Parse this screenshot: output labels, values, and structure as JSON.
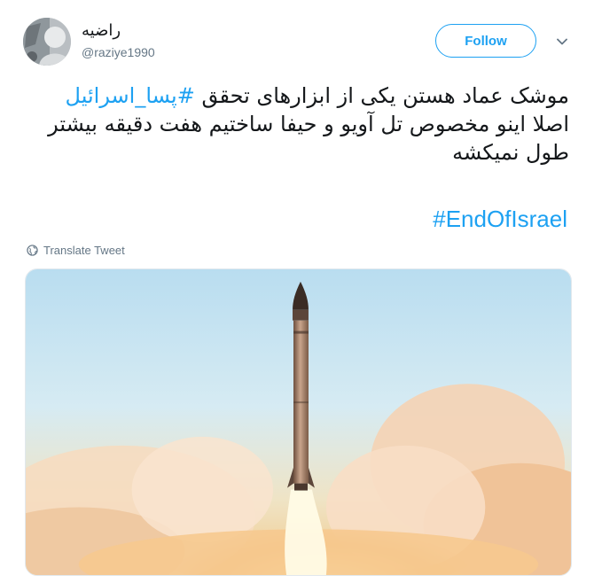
{
  "user": {
    "display_name": "راضیه",
    "handle": "@raziye1990"
  },
  "follow_label": "Follow",
  "tweet": {
    "line1_text": "موشک عماد هستن یکی از ابزارهای تحقق ",
    "line1_hashtag": "#پسا_اسرائیل",
    "line2": "اصلا اینو مخصوص تل آویو و حیفا ساختیم هفت دقیقه بیشتر",
    "line3": "طول نمیکشه",
    "hashtag_en": "#EndOfIsrael"
  },
  "translate_label": "Translate Tweet",
  "icons": {
    "globe": "globe-icon",
    "caret": "chevron-down-icon"
  },
  "colors": {
    "accent": "#1da1f2",
    "muted": "#657786"
  }
}
